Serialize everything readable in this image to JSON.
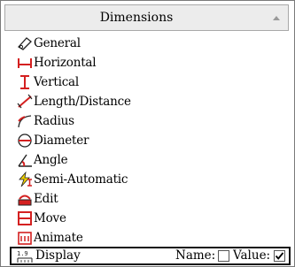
{
  "panel": {
    "title": "Dimensions"
  },
  "items": [
    {
      "label": "General",
      "icon": "general-dimension-icon"
    },
    {
      "label": "Horizontal",
      "icon": "horizontal-dimension-icon"
    },
    {
      "label": "Vertical",
      "icon": "vertical-dimension-icon"
    },
    {
      "label": "Length/Distance",
      "icon": "length-distance-icon"
    },
    {
      "label": "Radius",
      "icon": "radius-icon"
    },
    {
      "label": "Diameter",
      "icon": "diameter-icon"
    },
    {
      "label": "Angle",
      "icon": "angle-icon"
    },
    {
      "label": "Semi-Automatic",
      "icon": "semi-automatic-icon"
    },
    {
      "label": "Edit",
      "icon": "edit-dimension-icon"
    },
    {
      "label": "Move",
      "icon": "move-dimension-icon"
    },
    {
      "label": "Animate",
      "icon": "animate-icon"
    }
  ],
  "display": {
    "label": "Display",
    "name_label": "Name:",
    "name_checked": false,
    "value_label": "Value:",
    "value_checked": true
  },
  "colors": {
    "icon_red": "#d42020",
    "icon_dark": "#222222",
    "icon_yellow": "#f0d000",
    "header_bg": "#ececec"
  }
}
